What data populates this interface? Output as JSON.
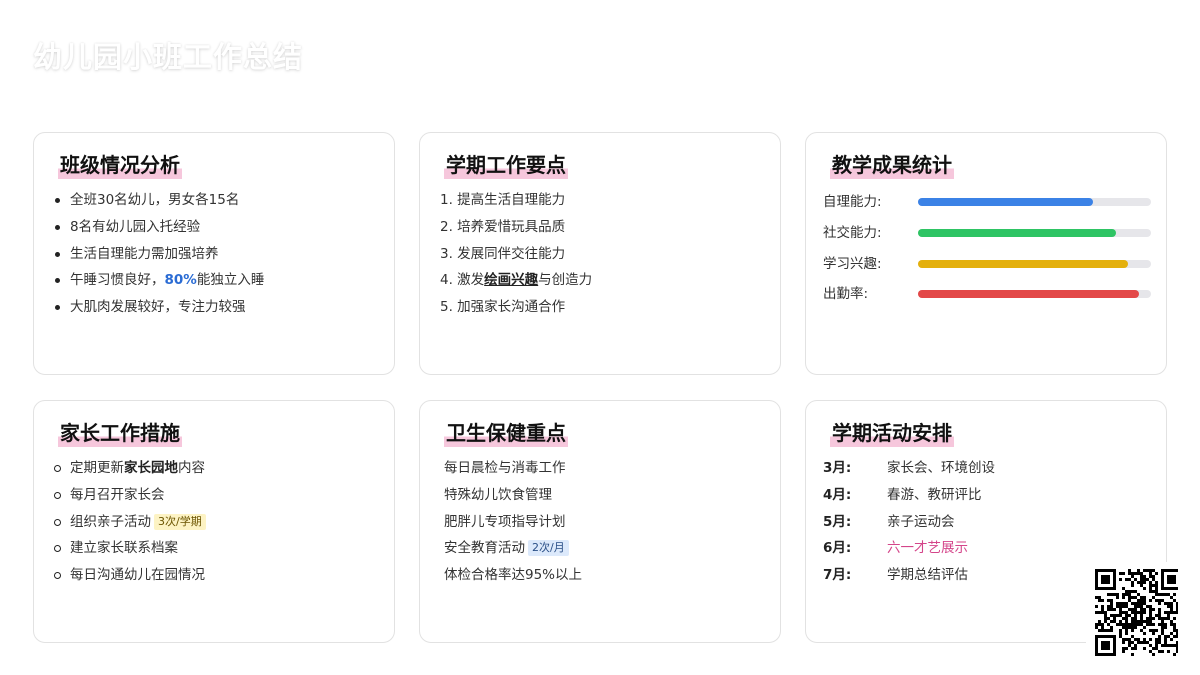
{
  "page": {
    "title": "幼儿园小班工作总结"
  },
  "class_analysis": {
    "title": "班级情况分析",
    "items": [
      {
        "text": "全班30名幼儿，男女各15名"
      },
      {
        "text": "8名有幼儿园入托经验"
      },
      {
        "text": "生活自理能力需加强培养"
      },
      {
        "before": "午睡习惯良好，",
        "highlight": "80%",
        "after": "能独立入睡"
      },
      {
        "text": "大肌肉发展较好，专注力较强"
      }
    ]
  },
  "semester_focus": {
    "title": "学期工作要点",
    "items": [
      {
        "text": "1. 提高生活自理能力"
      },
      {
        "text": "2. 培养爱惜玩具品质"
      },
      {
        "text": "3. 发展同伴交往能力"
      },
      {
        "before": "4. 激发",
        "highlight": "绘画兴趣",
        "after": "与创造力"
      },
      {
        "text": "5. 加强家长沟通合作"
      }
    ]
  },
  "results": {
    "title": "教学成果统计",
    "items": [
      {
        "label": "自理能力:",
        "value": 75,
        "color": "#3b82e6"
      },
      {
        "label": "社交能力:",
        "value": 85,
        "color": "#2ec464"
      },
      {
        "label": "学习兴趣:",
        "value": 90,
        "color": "#e4b00d"
      },
      {
        "label": "出勤率:",
        "value": 95,
        "color": "#e34848"
      }
    ]
  },
  "parent_work": {
    "title": "家长工作措施",
    "items": [
      {
        "before": "定期更新",
        "highlight": "家长园地",
        "after": "内容"
      },
      {
        "text": "每月召开家长会"
      },
      {
        "text": "组织亲子活动",
        "tag": "3次/学期"
      },
      {
        "text": "建立家长联系档案"
      },
      {
        "text": "每日沟通幼儿在园情况"
      }
    ]
  },
  "health": {
    "title": "卫生保健重点",
    "items": [
      {
        "text": "每日晨检与消毒工作"
      },
      {
        "text": "特殊幼儿饮食管理"
      },
      {
        "text": "肥胖儿专项指导计划"
      },
      {
        "text": "安全教育活动",
        "tag": "2次/月"
      },
      {
        "text": "体检合格率达95%以上"
      }
    ]
  },
  "activities": {
    "title": "学期活动安排",
    "items": [
      {
        "month": "3月:",
        "event": "家长会、环境创设"
      },
      {
        "month": "4月:",
        "event": "春游、教研评比"
      },
      {
        "month": "5月:",
        "event": "亲子运动会"
      },
      {
        "month": "6月:",
        "event": "六一才艺展示",
        "highlight": true
      },
      {
        "month": "7月:",
        "event": "学期总结评估"
      }
    ]
  }
}
